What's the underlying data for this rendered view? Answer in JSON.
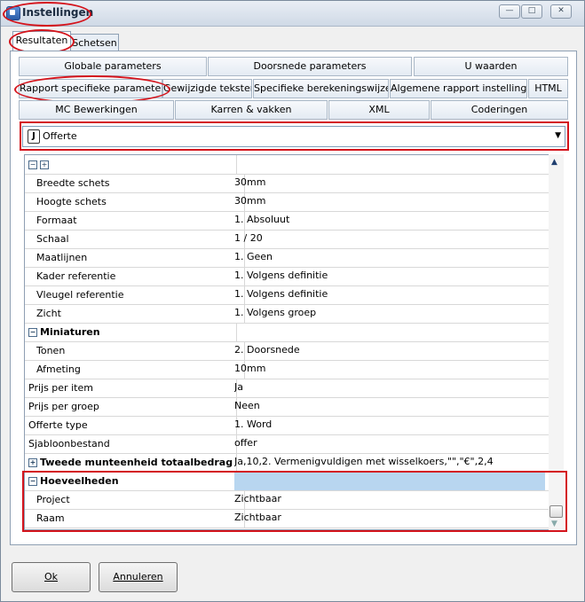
{
  "window": {
    "title": "Instellingen",
    "controls": {
      "minimize": "—",
      "maximize": "□",
      "close": "✕"
    }
  },
  "tabs": [
    {
      "label": "Resultaten",
      "active": true
    },
    {
      "label": "Schetsen",
      "active": false
    }
  ],
  "subtabs": {
    "row1": [
      "Globale parameters",
      "Doorsnede parameters",
      "U waarden"
    ],
    "row2": [
      "Rapport specifieke parameters",
      "Gewijzigde teksten",
      "Specifieke berekeningswijzen",
      "Algemene rapport instellingen",
      "HTML"
    ],
    "row3": [
      "MC Bewerkingen",
      "Karren & vakken",
      "XML",
      "Coderingen"
    ]
  },
  "report_selector": {
    "icon": "J",
    "value": "Offerte"
  },
  "property_grid": {
    "rows": [
      {
        "name": "Breedte schets",
        "value": "30mm"
      },
      {
        "name": "Hoogte schets",
        "value": "30mm"
      },
      {
        "name": "Formaat",
        "value": "1. Absoluut"
      },
      {
        "name": "Schaal",
        "value": "1 / 20"
      },
      {
        "name": "Maatlijnen",
        "value": "1. Geen"
      },
      {
        "name": "Kader referentie",
        "value": "1. Volgens definitie"
      },
      {
        "name": "Vleugel referentie",
        "value": "1. Volgens definitie"
      },
      {
        "name": "Zicht",
        "value": "1. Volgens groep"
      },
      {
        "name": "Miniaturen",
        "value": ""
      },
      {
        "name": "Tonen",
        "value": "2. Doorsnede"
      },
      {
        "name": "Afmeting",
        "value": "10mm"
      },
      {
        "name": "Prijs per item",
        "value": "Ja"
      },
      {
        "name": "Prijs per groep",
        "value": "Neen"
      },
      {
        "name": "Offerte type",
        "value": "1. Word"
      },
      {
        "name": "Sjabloonbestand",
        "value": "offer"
      },
      {
        "name": "Tweede munteenheid totaalbedrag",
        "value": "Ja,10,2. Vermenigvuldigen met wisselkoers,\"\",\"€\",2,4"
      },
      {
        "name": "Hoeveelheden",
        "value": ""
      },
      {
        "name": "Project",
        "value": "Zichtbaar"
      },
      {
        "name": "Raam",
        "value": "Zichtbaar"
      }
    ]
  },
  "buttons": {
    "ok": "Ok",
    "cancel": "Annuleren"
  },
  "colors": {
    "annotation": "#d4141c",
    "highlight_row": "#b8d6f0"
  }
}
